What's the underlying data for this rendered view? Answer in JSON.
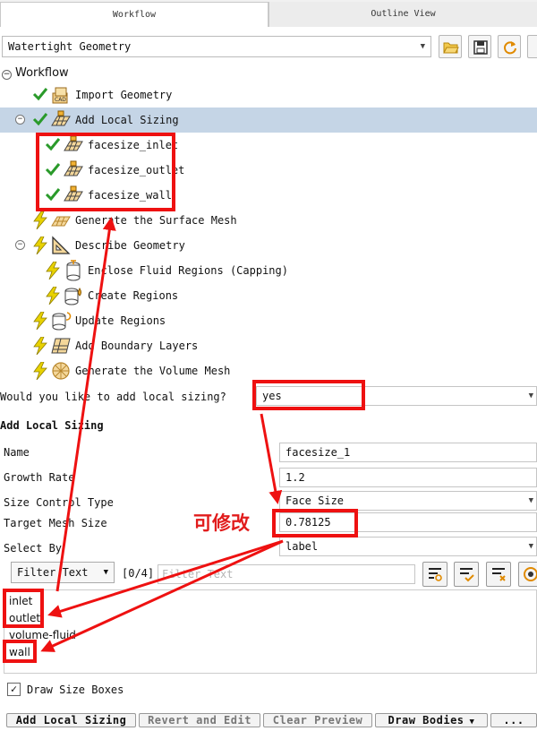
{
  "tabs": {
    "workflow": "Workflow",
    "outline": "Outline View"
  },
  "workflow_select": {
    "value": "Watertight Geometry"
  },
  "tree": {
    "title": "Workflow",
    "items": [
      {
        "label": "Import Geometry",
        "status": "done",
        "icon": "cad-import-icon"
      },
      {
        "label": "Add Local Sizing",
        "status": "done",
        "icon": "local-sizing-icon"
      },
      {
        "label": "facesize_inlet",
        "status": "done",
        "icon": "mesh-grid-icon"
      },
      {
        "label": "facesize_outlet",
        "status": "done",
        "icon": "mesh-grid-icon"
      },
      {
        "label": "facesize_wall",
        "status": "done",
        "icon": "mesh-grid-icon"
      },
      {
        "label": "Generate the Surface Mesh",
        "status": "pending",
        "icon": "surface-mesh-icon"
      },
      {
        "label": "Describe Geometry",
        "status": "pending",
        "icon": "describe-geometry-icon"
      },
      {
        "label": "Enclose Fluid Regions (Capping)",
        "status": "pending",
        "icon": "capping-icon"
      },
      {
        "label": "Create Regions",
        "status": "pending",
        "icon": "create-regions-icon"
      },
      {
        "label": "Update Regions",
        "status": "pending",
        "icon": "update-regions-icon"
      },
      {
        "label": "Add Boundary Layers",
        "status": "pending",
        "icon": "boundary-layers-icon"
      },
      {
        "label": "Generate the Volume Mesh",
        "status": "pending",
        "icon": "volume-mesh-icon"
      }
    ]
  },
  "task": {
    "question": "Would you like to add local sizing?",
    "answer": "yes",
    "section_title": "Add Local Sizing",
    "props": {
      "name": {
        "label": "Name",
        "value": "facesize_1"
      },
      "growth_rate": {
        "label": "Growth Rate",
        "value": "1.2"
      },
      "size_control_type": {
        "label": "Size Control Type",
        "value": "Face Size"
      },
      "target_mesh_size": {
        "label": "Target Mesh Size",
        "value": "0.78125"
      },
      "select_by": {
        "label": "Select By",
        "value": "label"
      }
    },
    "filter": {
      "mode": "Filter Text",
      "count": "[0/4]",
      "placeholder": "Filter Text"
    },
    "list_items": [
      "inlet",
      "outlet",
      "volume-fluid",
      "wall"
    ],
    "draw_size_boxes": {
      "label": "Draw Size Boxes",
      "checked": true
    }
  },
  "buttons": {
    "add": "Add Local Sizing",
    "revert": "Revert and Edit",
    "clear": "Clear Preview",
    "draw": "Draw Bodies",
    "more": "..."
  },
  "annotation": {
    "text": "可修改"
  },
  "colors": {
    "annotation": "#ee1111",
    "check": "#2a9a2a",
    "lightning": "#e8d200",
    "selected_row": "#c5d5e6"
  }
}
